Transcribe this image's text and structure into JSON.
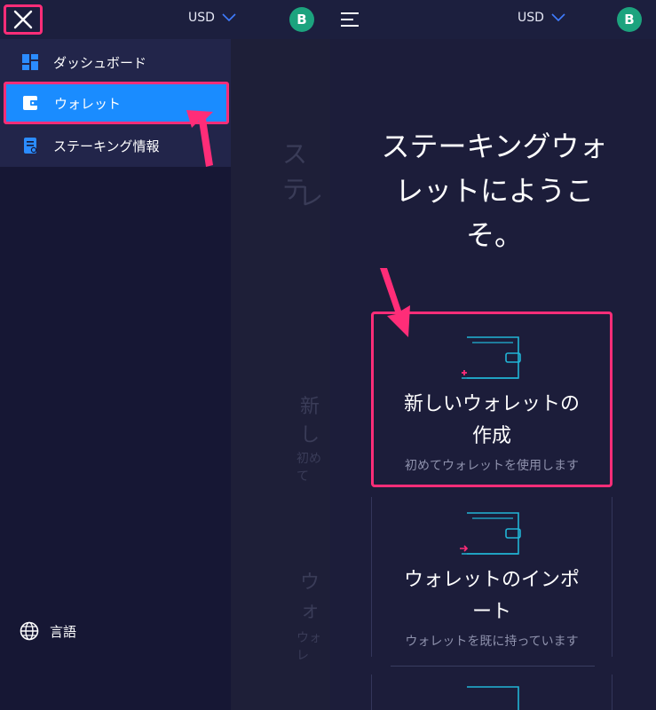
{
  "topbar": {
    "currency": "USD",
    "avatar_initial": "B"
  },
  "sidebar": {
    "items": [
      {
        "label": "ダッシュボード",
        "icon": "dashboard-icon"
      },
      {
        "label": "ウォレット",
        "icon": "wallet-icon",
        "active": true
      },
      {
        "label": "ステーキング情報",
        "icon": "document-icon"
      }
    ],
    "language_label": "言語"
  },
  "main": {
    "welcome_title": "ステーキングウォレットにようこそ。",
    "welcome_lines": [
      "ステーキングウォ",
      "レットにようこ",
      "そ。"
    ],
    "cards": [
      {
        "title_lines": [
          "新しいウォレットの",
          "作成"
        ],
        "subtitle": "初めてウォレットを使用します",
        "icon": "wallet-plus-icon"
      },
      {
        "title_lines": [
          "ウォレットのインポ",
          "ート"
        ],
        "subtitle": "ウォレットを既に持っています",
        "icon": "wallet-import-icon"
      }
    ]
  },
  "overlay_ghost": {
    "title_lines": [
      "ステ",
      "レ"
    ],
    "card1": "新し",
    "card1_sub": "初めて",
    "card2": "ウォ",
    "card2_sub": "ウォレ"
  },
  "colors": {
    "highlight": "#ff2d78",
    "active_item": "#1a8cff",
    "avatar": "#1ca37e",
    "accent_cyan": "#21b5d6"
  }
}
